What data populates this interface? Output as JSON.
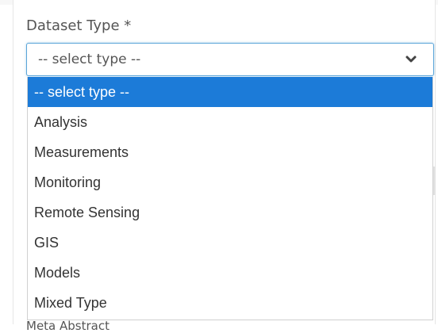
{
  "field": {
    "label": "Dataset Type *",
    "selected_value": "-- select type --",
    "chevron_icon": "chevron-down-icon"
  },
  "dropdown": {
    "options": [
      {
        "label": "-- select type --",
        "selected": true
      },
      {
        "label": "Analysis",
        "selected": false
      },
      {
        "label": "Measurements",
        "selected": false
      },
      {
        "label": "Monitoring",
        "selected": false
      },
      {
        "label": "Remote Sensing",
        "selected": false
      },
      {
        "label": "GIS",
        "selected": false
      },
      {
        "label": "Models",
        "selected": false
      },
      {
        "label": "Mixed Type",
        "selected": false
      }
    ],
    "highlight_color": "#1c7bd8"
  },
  "next_field": {
    "label": "Meta Abstract"
  }
}
